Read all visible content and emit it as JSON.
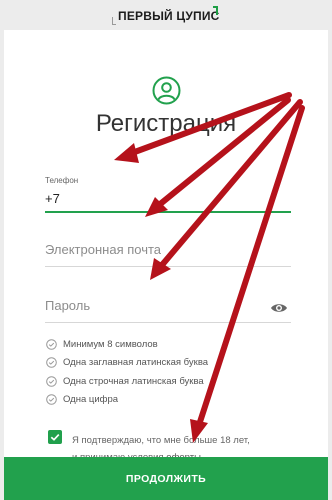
{
  "header": {
    "logo_text": "ПЕРВЫЙ ЦУПИС"
  },
  "form": {
    "title": "Регистрация",
    "phone_label": "Телефон",
    "phone_value": "+7",
    "email_placeholder": "Электронная почта",
    "password_placeholder": "Пароль",
    "requirements": [
      "Минимум 8 символов",
      "Одна заглавная латинская буква",
      "Одна строчная латинская буква",
      "Одна цифра"
    ],
    "consent_line1": "Я подтверждаю, что мне больше 18 лет,",
    "consent_line2_prefix": "и принимаю условия ",
    "consent_link": "оферты",
    "submit_label": "ПРОДОЛЖИТЬ",
    "consent_checked": true
  },
  "icons": {
    "avatar": "user-circle-icon",
    "password_toggle": "eye-icon",
    "requirement": "check-circle-icon",
    "consent": "checkbox-checked-icon"
  },
  "colors": {
    "accent": "#22a14d",
    "annotation_arrow": "#b5121b"
  }
}
